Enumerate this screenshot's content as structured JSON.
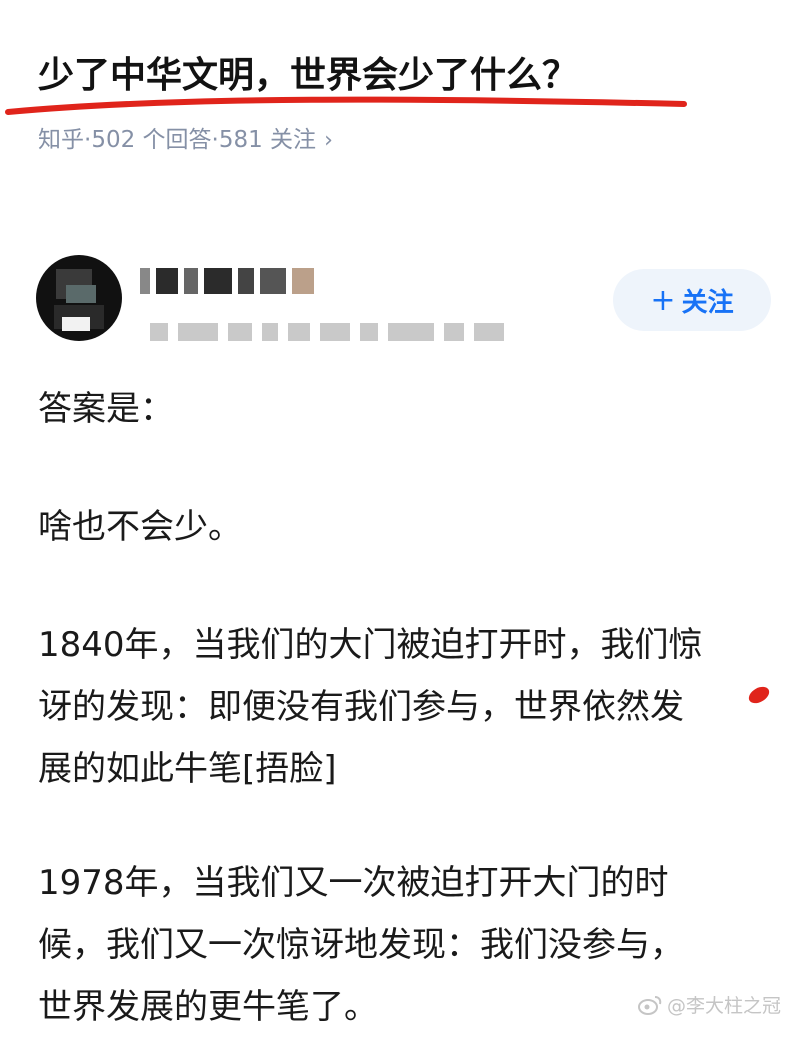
{
  "question": {
    "title": "少了中华文明，世界会少了什么？",
    "source": "知乎",
    "answers_count": "502 个回答",
    "followers_count": "581 关注",
    "chevron_icon": "chevron-right-icon",
    "underline_color": "#e0241b"
  },
  "author": {
    "avatar_icon": "user-avatar-icon",
    "name_blurred": true,
    "bio_blurred": true
  },
  "follow_button": {
    "icon": "plus-icon",
    "label": "关注",
    "bg_color": "#eef4fb",
    "text_color": "#1772f6"
  },
  "answer": {
    "p1": "答案是：",
    "p2": "啥也不会少。",
    "p3_line1": "1840年，当我们的大门被迫打开时，我们惊",
    "p3_line2": "讶的发现：即便没有我们参与，世界依然发",
    "p3_line3": "展的如此牛笔[捂脸]",
    "p4_line1": "1978年，当我们又一次被迫打开大门的时",
    "p4_line2": "候，我们又一次惊讶地发现：我们没参与，",
    "p4_line3": "世界发展的更牛笔了。"
  },
  "watermark": {
    "icon": "weibo-icon",
    "text": "@李大柱之冠"
  }
}
